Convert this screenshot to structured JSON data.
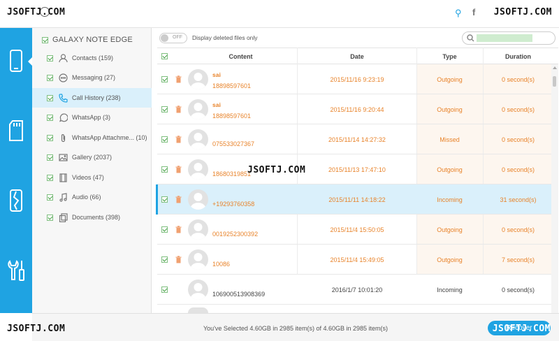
{
  "watermark": "JSOFTJ.COM",
  "device": {
    "name": "GALAXY NOTE EDGE"
  },
  "sidebar": {
    "items": [
      {
        "label": "Contacts (159)"
      },
      {
        "label": "Messaging (27)"
      },
      {
        "label": "Call History (238)"
      },
      {
        "label": "WhatsApp (3)"
      },
      {
        "label": "WhatsApp Attachme... (10)"
      },
      {
        "label": "Gallery (2037)"
      },
      {
        "label": "Videos (47)"
      },
      {
        "label": "Audio (66)"
      },
      {
        "label": "Documents (398)"
      }
    ]
  },
  "toolbar": {
    "toggle_text": "OFF",
    "toggle_label": "Display deleted files only"
  },
  "table": {
    "headers": {
      "content": "Content",
      "date": "Date",
      "type": "Type",
      "duration": "Duration"
    },
    "rows": [
      {
        "name": "sai",
        "number": "18898597601",
        "date": "2015/11/16 9:23:19",
        "type": "Outgoing",
        "duration": "0 second(s)"
      },
      {
        "name": "sai",
        "number": "18898597601",
        "date": "2015/11/16 9:20:44",
        "type": "Outgoing",
        "duration": "0 second(s)"
      },
      {
        "name": "",
        "number": "075533027367",
        "date": "2015/11/14 14:27:32",
        "type": "Missed",
        "duration": "0 second(s)"
      },
      {
        "name": "",
        "number": "18680319851",
        "date": "2015/11/13 17:47:10",
        "type": "Outgoing",
        "duration": "0 second(s)"
      },
      {
        "name": "",
        "number": "+19293760358",
        "date": "2015/11/11 14:18:22",
        "type": "Incoming",
        "duration": "31 second(s)"
      },
      {
        "name": "",
        "number": "0019252300392",
        "date": "2015/11/4 15:50:05",
        "type": "Outgoing",
        "duration": "0 second(s)"
      },
      {
        "name": "",
        "number": "10086",
        "date": "2015/11/4 15:49:05",
        "type": "Outgoing",
        "duration": "7 second(s)"
      },
      {
        "name": "",
        "number": "106900513908369",
        "date": "2016/1/7 10:01:20",
        "type": "Incoming",
        "duration": "0 second(s)"
      }
    ]
  },
  "footer": {
    "status": "You've Selected 4.60GB in 2985 item(s) of 4.60GB in 2985 item(s)",
    "recover_label": "Recover"
  },
  "colors": {
    "accent": "#1fa3e2",
    "deleted_text": "#e8832a",
    "selected_row": "#daf0fb"
  }
}
